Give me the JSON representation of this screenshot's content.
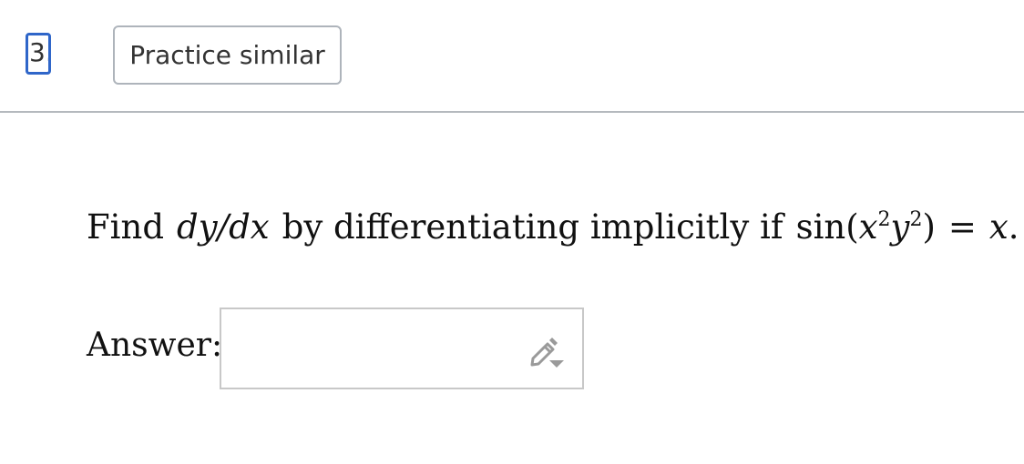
{
  "question_number": "3.",
  "practice_button_label": "Practice similar",
  "question": {
    "text_find": "Find",
    "derivative": "dy/dx",
    "text_middle": "by differentiating implicitly if",
    "func": "sin",
    "open_paren": "(",
    "x": "x",
    "exp_x": "2",
    "y": "y",
    "exp_y": "2",
    "close_paren": ")",
    "equals": "=",
    "rhs": "x",
    "period": "."
  },
  "answer": {
    "label": "Answer:",
    "value": ""
  },
  "icons": {
    "edit": "pencil-icon"
  },
  "colors": {
    "question_number_border": "#2f66c9",
    "divider": "#b5b9be",
    "button_border": "#aeb4bb",
    "answer_border": "#c8c8c8"
  }
}
